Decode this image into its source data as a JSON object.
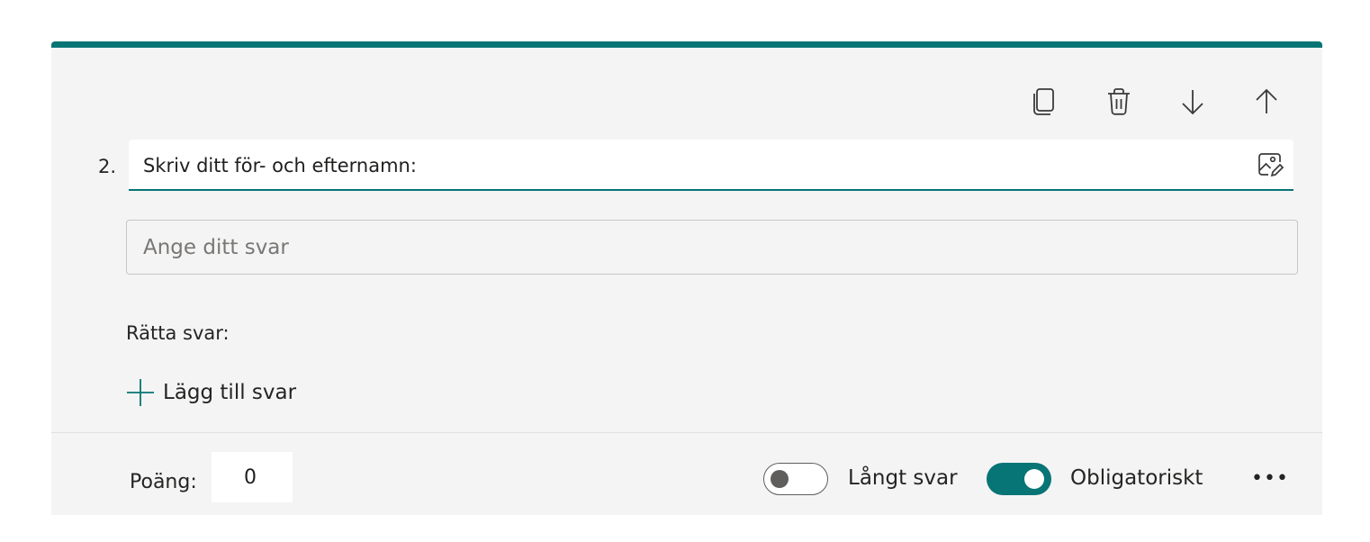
{
  "question": {
    "number": "2.",
    "title": "Skriv ditt för- och efternamn:"
  },
  "answer": {
    "placeholder": "Ange ditt svar"
  },
  "correct_answers": {
    "label": "Rätta svar:",
    "add_label": "Lägg till svar"
  },
  "footer": {
    "points_label": "Poäng:",
    "points_value": "0",
    "long_answer_label": "Långt svar",
    "long_answer_on": false,
    "required_label": "Obligatoriskt",
    "required_on": true,
    "more_label": "•••"
  },
  "toolbar": {
    "icons": [
      "copy-icon",
      "delete-icon",
      "move-down-icon",
      "move-up-icon"
    ]
  },
  "colors": {
    "accent": "#077475",
    "card_background": "#f4f4f4"
  }
}
